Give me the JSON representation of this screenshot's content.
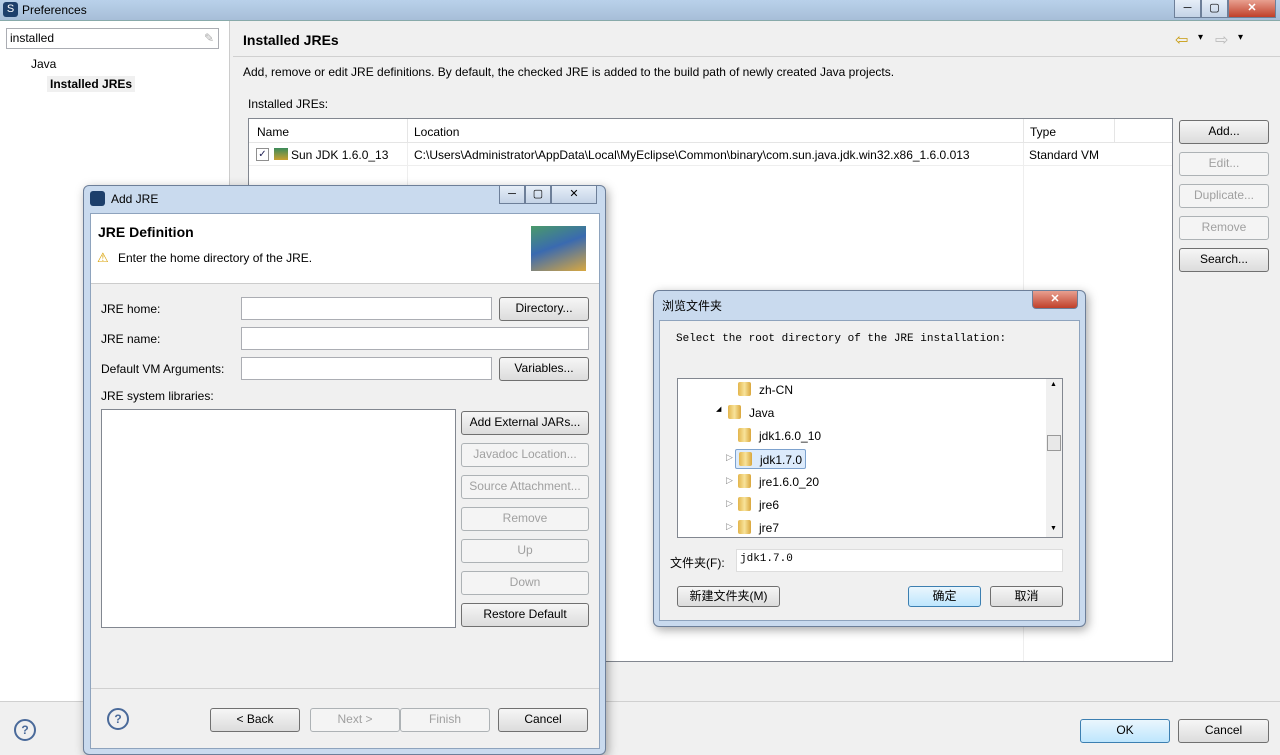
{
  "window": {
    "title": "Preferences",
    "min": "─",
    "max": "▢",
    "close": "✕"
  },
  "filter": {
    "value": "installed"
  },
  "tree": {
    "parent": "Java",
    "child": "Installed JREs"
  },
  "page": {
    "title": "Installed JREs",
    "description": "Add, remove or edit JRE definitions. By default, the checked JRE is added to the build path of newly created Java projects.",
    "table_label": "Installed JREs:",
    "nav_back": "⇦",
    "nav_fwd": "⇨",
    "menu": "▾"
  },
  "table": {
    "columns": [
      "Name",
      "Location",
      "Type"
    ],
    "rows": [
      {
        "checked": true,
        "name": "Sun JDK 1.6.0_13",
        "location": "C:\\Users\\Administrator\\AppData\\Local\\MyEclipse\\Common\\binary\\com.sun.java.jdk.win32.x86_1.6.0.013",
        "type": "Standard VM"
      }
    ]
  },
  "side_buttons": {
    "add": "Add...",
    "edit": "Edit...",
    "duplicate": "Duplicate...",
    "remove": "Remove",
    "search": "Search..."
  },
  "footer": {
    "help": "?",
    "ok": "OK",
    "cancel": "Cancel"
  },
  "add_jre": {
    "title": "Add JRE",
    "header": "JRE Definition",
    "message": "Enter the home directory of the JRE.",
    "jre_home_label": "JRE home:",
    "jre_home_value": "",
    "directory": "Directory...",
    "jre_name_label": "JRE name:",
    "jre_name_value": "",
    "vm_args_label": "Default VM Arguments:",
    "vm_args_value": "",
    "variables": "Variables...",
    "libs_label": "JRE system libraries:",
    "add_ext": "Add External JARs...",
    "javadoc": "Javadoc Location...",
    "source": "Source Attachment...",
    "remove": "Remove",
    "up": "Up",
    "down": "Down",
    "restore": "Restore Default",
    "back": "< Back",
    "next": "Next >",
    "finish": "Finish",
    "cancel": "Cancel",
    "help": "?"
  },
  "browse": {
    "title": "浏览文件夹",
    "prompt": "Select the root directory of the JRE installation:",
    "items": [
      {
        "label": "zh-CN",
        "expander": ""
      },
      {
        "label": "Java",
        "expander": "◢"
      },
      {
        "label": "jdk1.6.0_10",
        "expander": ""
      },
      {
        "label": "jdk1.7.0",
        "expander": "▷",
        "selected": true
      },
      {
        "label": "jre1.6.0_20",
        "expander": "▷"
      },
      {
        "label": "jre6",
        "expander": "▷"
      },
      {
        "label": "jre7",
        "expander": "▷"
      }
    ],
    "folder_label": "文件夹(F):",
    "folder_value": "jdk1.7.0",
    "new_folder": "新建文件夹(M)",
    "ok": "确定",
    "cancel": "取消",
    "close": "✕"
  }
}
